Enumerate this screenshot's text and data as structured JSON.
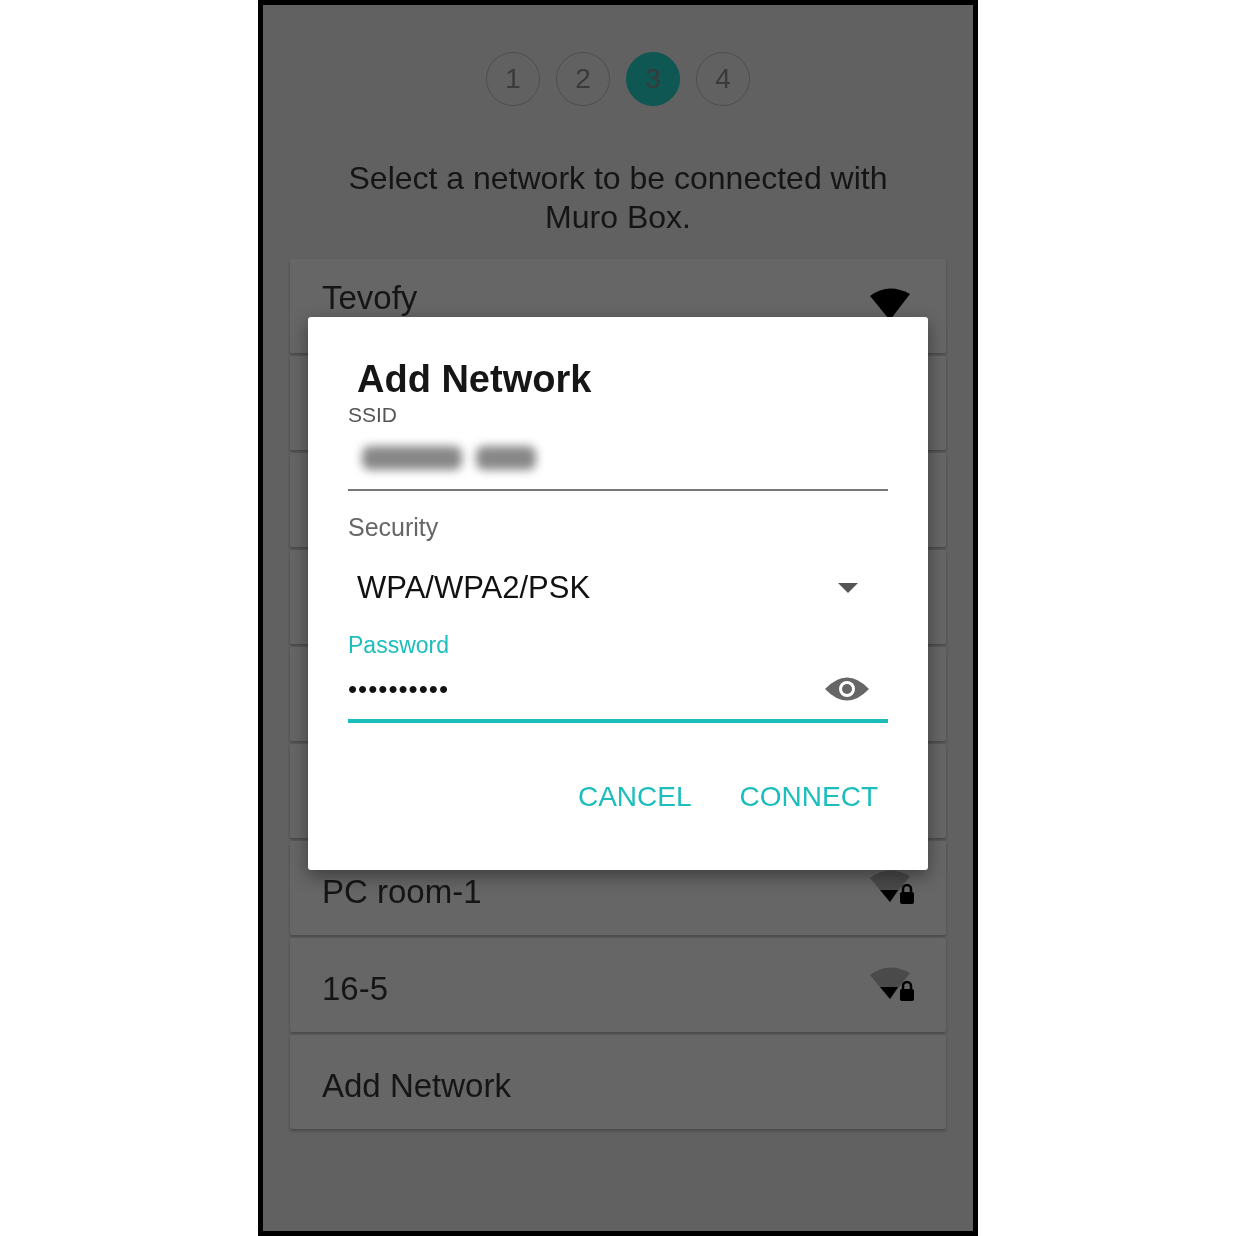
{
  "steps": [
    {
      "label": "1",
      "selected": false
    },
    {
      "label": "2",
      "selected": false
    },
    {
      "label": "3",
      "selected": true
    },
    {
      "label": "4",
      "selected": false
    }
  ],
  "instruction": "Select a network to be connected with Muro Box.",
  "networks": [
    {
      "kind": "network",
      "name": "Tevofy",
      "weak_signal": false
    },
    {
      "kind": "covered"
    },
    {
      "kind": "covered"
    },
    {
      "kind": "covered"
    },
    {
      "kind": "covered"
    },
    {
      "kind": "covered"
    },
    {
      "kind": "network",
      "name": "PC room-1",
      "weak_signal": true
    },
    {
      "kind": "network",
      "name": "16-5",
      "weak_signal": true
    },
    {
      "kind": "action",
      "name": "Add Network"
    }
  ],
  "dialog": {
    "title": "Add Network",
    "ssid": {
      "label": "SSID"
    },
    "security": {
      "label": "Security",
      "value": "WPA/WPA2/PSK"
    },
    "password": {
      "label": "Password",
      "value": "••••••••••",
      "focused": true
    },
    "buttons": [
      "CANCEL",
      "CONNECT"
    ]
  }
}
